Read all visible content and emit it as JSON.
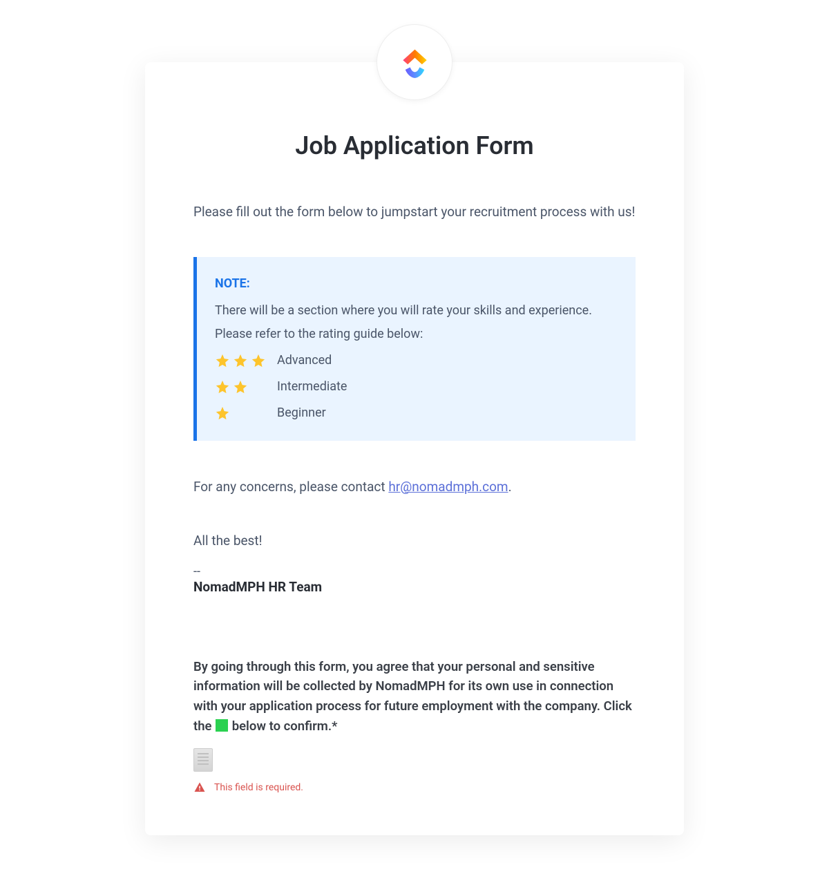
{
  "title": "Job Application Form",
  "intro": "Please fill out the form below to jumpstart your recruitment process with us!",
  "note": {
    "title": "NOTE:",
    "body": "There will be a section where you will rate your skills and experience. Please refer to the rating guide below:",
    "ratings": [
      {
        "stars": 3,
        "label": "Advanced"
      },
      {
        "stars": 2,
        "label": "Intermediate"
      },
      {
        "stars": 1,
        "label": "Beginner"
      }
    ]
  },
  "contact_prefix": "For any concerns, please contact ",
  "contact_email": "hr@nomadmph.com",
  "contact_suffix": ".",
  "signoff": "All the best!",
  "divider": "--",
  "team": "NomadMPH HR Team",
  "consent_pre": "By going through this form, you agree that your personal and sensitive information will be collected by NomadMPH for its own use in connection with your application process for future employment with the company. Click the ",
  "consent_post": " below to confirm.*",
  "error": "This field is required."
}
